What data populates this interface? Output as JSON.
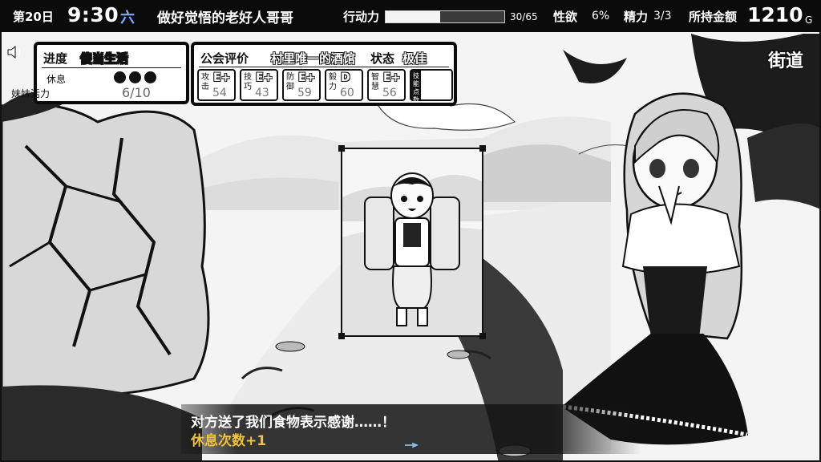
{
  "topbar": {
    "day": "第20日",
    "time": "9:30",
    "weekday": "六",
    "quest": "做好觉悟的老好人哥哥",
    "action_points_label": "行动力",
    "action_points_value": "30/65",
    "action_points_fraction": 0.46,
    "lust_label": "性欲",
    "lust_value": "6%",
    "energy_label": "精力",
    "energy_value": "3/3",
    "money_label": "所持金额",
    "money_value": "1210",
    "money_unit": "G"
  },
  "progress": {
    "label": "进度",
    "state": "傻当生活",
    "rest_label": "休息",
    "rest_filled": 3,
    "vitality_label": "妹妹活力",
    "vitality_value": "6/10"
  },
  "guild": {
    "rating_label": "公会评价",
    "rating_value": "村里唯一的酒馆",
    "status_label": "状态",
    "status_value": "极佳",
    "stats": [
      {
        "name": "攻击",
        "grade": "E+",
        "value": "54"
      },
      {
        "name": "技巧",
        "grade": "E+",
        "value": "43"
      },
      {
        "name": "防御",
        "grade": "E+",
        "value": "59"
      },
      {
        "name": "毅力",
        "grade": "D",
        "value": "60"
      },
      {
        "name": "智慧",
        "grade": "E+",
        "value": "56"
      }
    ],
    "skill_points_label": "技能点数"
  },
  "location": "街道",
  "dialogue": {
    "line1": "对方送了我们食物表示感谢……！",
    "line2": "休息次数+1"
  },
  "colors": {
    "topbar_bg": "#0b0b0b",
    "weekday_accent": "#7fa8ff",
    "highlight_text": "#f0c040"
  },
  "icons": {
    "sound": "speaker-icon",
    "advance": "next-arrow-icon"
  }
}
